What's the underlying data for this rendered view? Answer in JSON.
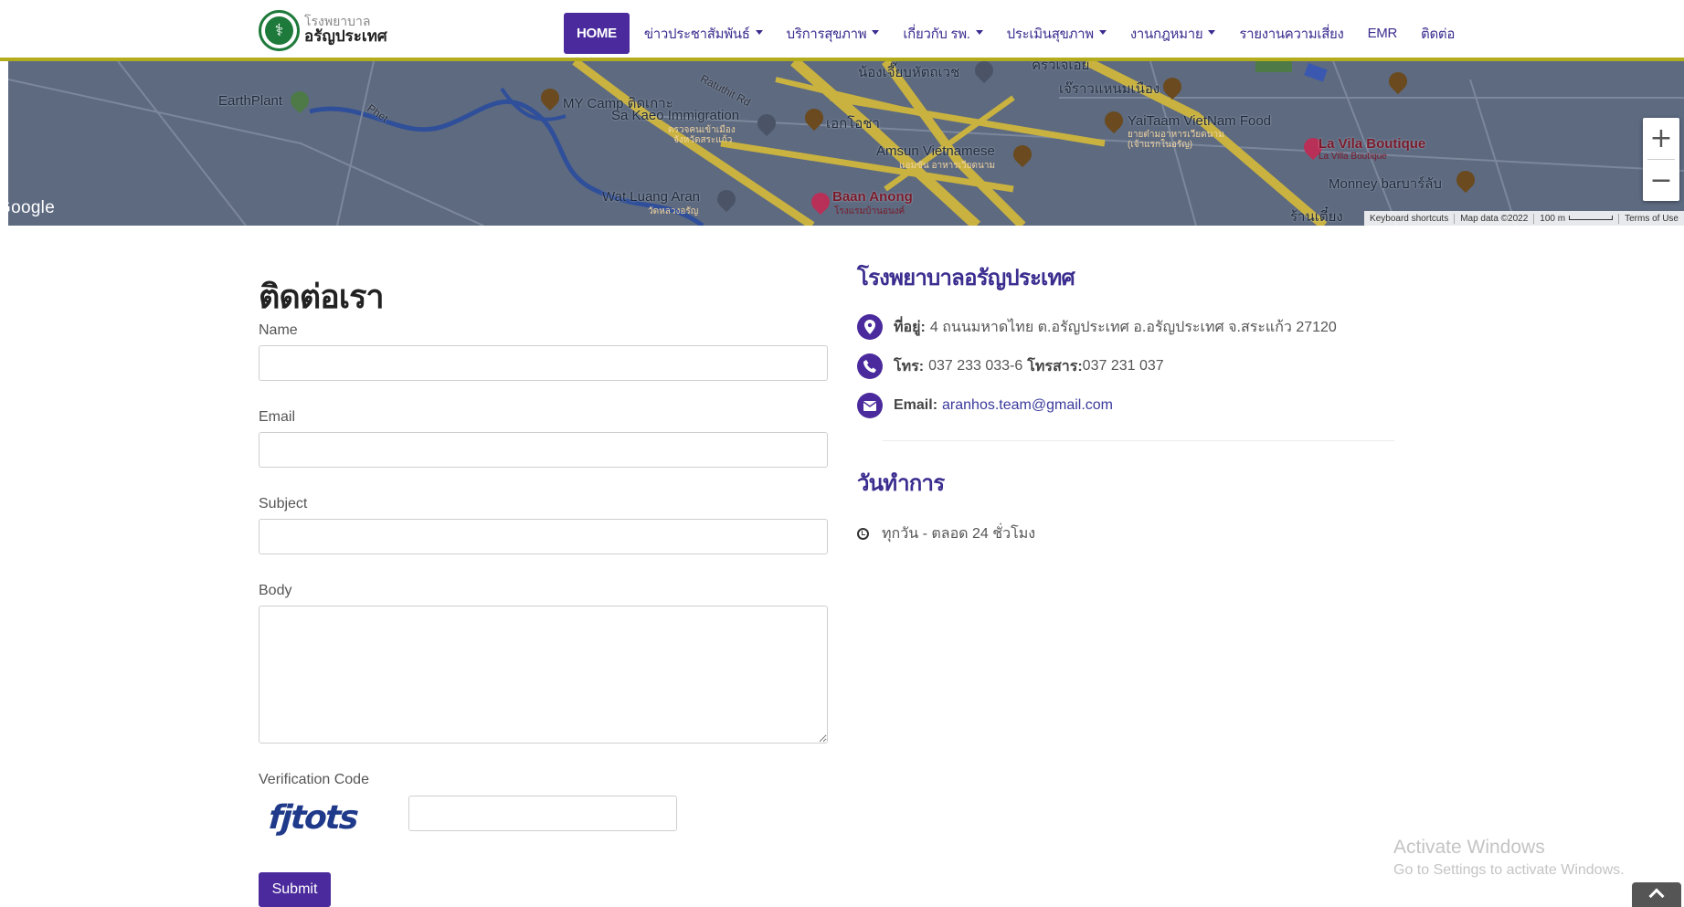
{
  "header": {
    "logo_line1": "โรงพยาบาล",
    "logo_line2": "อรัญประเทศ",
    "nav": [
      {
        "label": "HOME",
        "active": true,
        "dropdown": false
      },
      {
        "label": "ข่าวประชาสัมพันธ์",
        "dropdown": true
      },
      {
        "label": "บริการสุขภาพ",
        "dropdown": true
      },
      {
        "label": "เกี่ยวกับ รพ.",
        "dropdown": true
      },
      {
        "label": "ประเมินสุขภาพ",
        "dropdown": true
      },
      {
        "label": "งานกฎหมาย",
        "dropdown": true
      },
      {
        "label": "รายงานความเสี่ยง",
        "dropdown": false
      },
      {
        "label": "EMR",
        "dropdown": false
      },
      {
        "label": "ติดต่อ",
        "dropdown": false
      }
    ],
    "accent_color": "#4a2a9c",
    "border_color": "#b3ac1c"
  },
  "map": {
    "google_label": "Google",
    "labels": {
      "earthplant": "EarthPlant",
      "my_camp": "MY Camp ติดเกาะ",
      "sa_kaeo_immigration": "Sa Kaeo Immigration",
      "sa_kaeo_sub1": "ตรวจคนเข้าเมือง",
      "sa_kaeo_sub2": "จังหวัดสระแก้ว",
      "ekosa": "เอกโอชา",
      "amsun": "Amsun Vietnamese",
      "amsun_sub": "แอมซัน อาหารเวียดนาม",
      "nong_jeab": "น้องเจี๊ยบหัตถเวช",
      "krua_jeab": "ครัวเจ้เอย",
      "jerawaeng": "เจ๊ราวแหนมเนือง",
      "yaitaam": "YaiTaam VietNam Food",
      "yaitaam_sub1": "ยายต๋ามอาหารเวียดนาม",
      "yaitaam_sub2": "(เจ้าแรกในอรัญ)",
      "la_vila": "La Vila Boutique",
      "la_vila_sub": "La Villa Boutique",
      "monney": "Monney barบาร์ลับ",
      "wat_luang": "Wat Luang Aran",
      "wat_luang_sub": "วัดหลวงอรัญ",
      "baan_anong": "Baan Anong",
      "baan_anong_sub": "โรงแรมบ้านอนงค์",
      "ratuthit_rd": "Ratuthit Rd",
      "phet": "Phet",
      "ran_tieng": "ร้านเตี๋ยง"
    },
    "zoom_in": "+",
    "zoom_out": "−",
    "attribution": {
      "keyboard": "Keyboard shortcuts",
      "map_data": "Map data ©2022",
      "scale": "100 m",
      "terms": "Terms of Use"
    }
  },
  "contact_form": {
    "title": "ติดต่อเรา",
    "fields": {
      "name": {
        "label": "Name",
        "value": ""
      },
      "email": {
        "label": "Email",
        "value": ""
      },
      "subject": {
        "label": "Subject",
        "value": ""
      },
      "body": {
        "label": "Body",
        "value": ""
      }
    },
    "verification": {
      "label": "Verification Code",
      "captcha_text": "fjtots",
      "value": ""
    },
    "submit_label": "Submit"
  },
  "info": {
    "hospital_name": "โรงพยาบาลอรัญประเทศ",
    "address_label": "ที่อยู่:",
    "address": "4 ถนนมหาดไทย ต.อรัญประเทศ อ.อรัญประเทศ จ.สระแก้ว 27120",
    "phone_label": "โทร:",
    "phone": "037 233 033-6",
    "fax_label": "โทรสาร:",
    "fax": "037 231 037",
    "email_label": "Email:",
    "email": "aranhos.team@gmail.com",
    "hours_title": "วันทำการ",
    "hours": "ทุกวัน - ตลอด 24 ชั่วโมง"
  },
  "windows_watermark": {
    "line1": "Activate Windows",
    "line2": "Go to Settings to activate Windows."
  }
}
